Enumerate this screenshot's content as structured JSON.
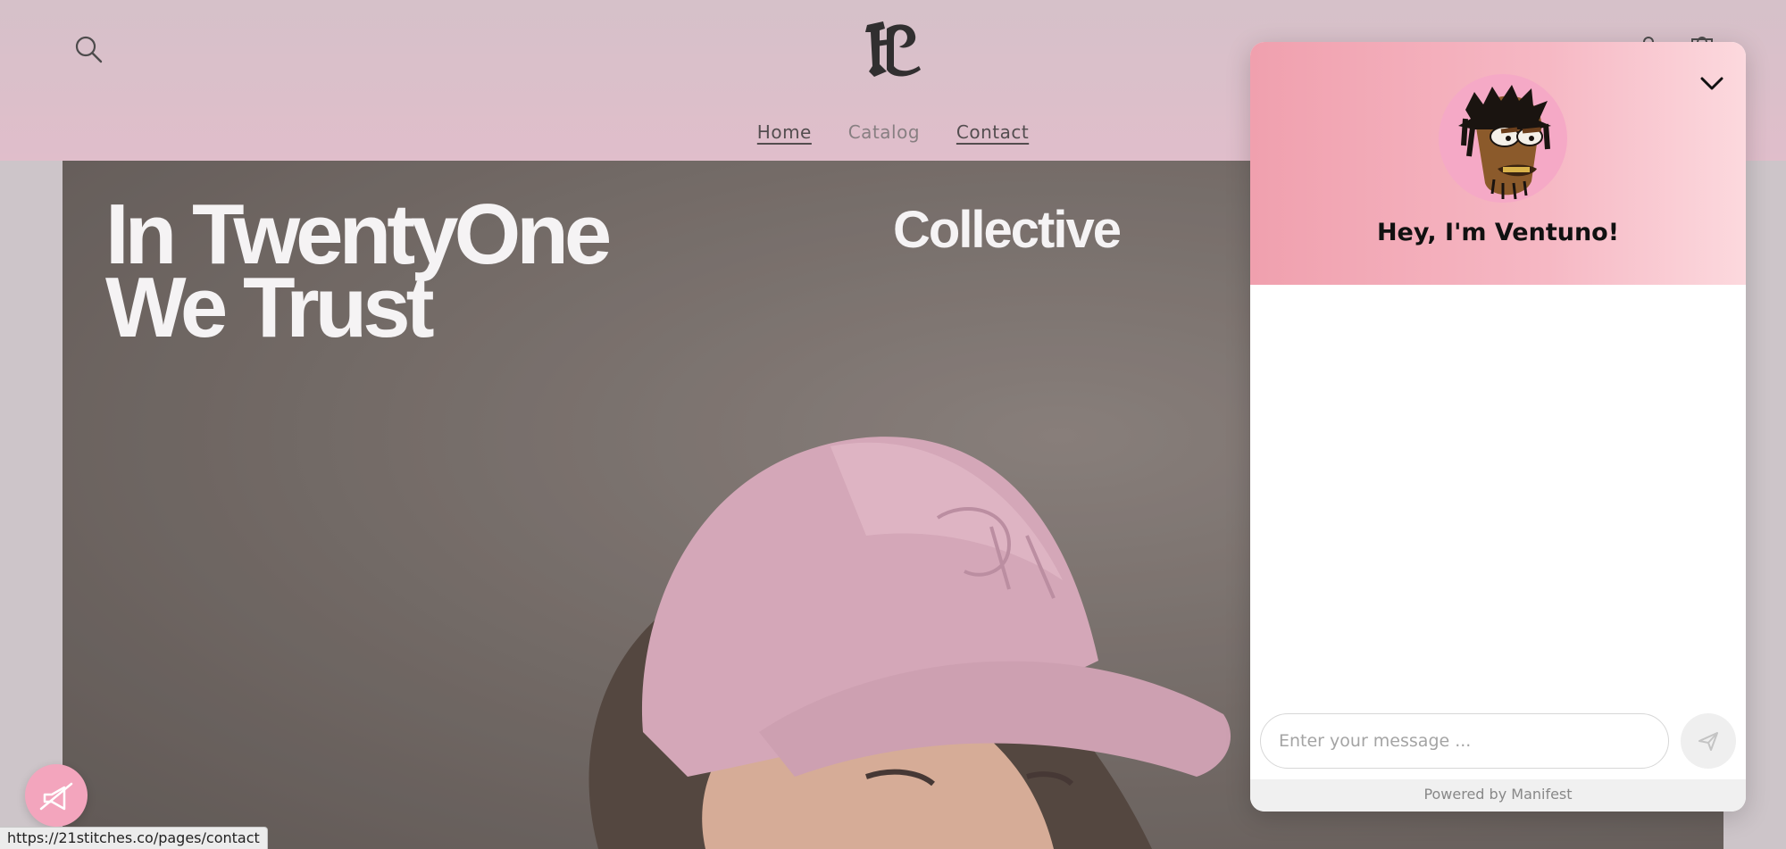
{
  "site": {
    "nav": [
      {
        "label": "Home"
      },
      {
        "label": "Catalog"
      },
      {
        "label": "Contact"
      }
    ],
    "icons": {
      "search": "search-icon",
      "logo": "blackletter-logo",
      "account": "account-icon",
      "cart": "cart-icon"
    }
  },
  "hero": {
    "title_line1": "In TwentyOne",
    "title_line2": "We Trust",
    "collective": "Collective"
  },
  "chat": {
    "title": "Hey, I'm Ventuno!",
    "input_placeholder": "Enter your message ...",
    "powered_by": "Powered by Manifest",
    "header_colors": [
      "#f0a0ae",
      "#fcd9de"
    ],
    "icons": {
      "collapse": "chevron-down-icon",
      "send": "send-icon",
      "avatar": "cartoon-avatar"
    }
  },
  "launcher": {
    "icon": "megaphone-off-icon",
    "color": "#f3a5bd"
  },
  "status_bar": {
    "url": "https://21stitches.co/pages/contact"
  }
}
